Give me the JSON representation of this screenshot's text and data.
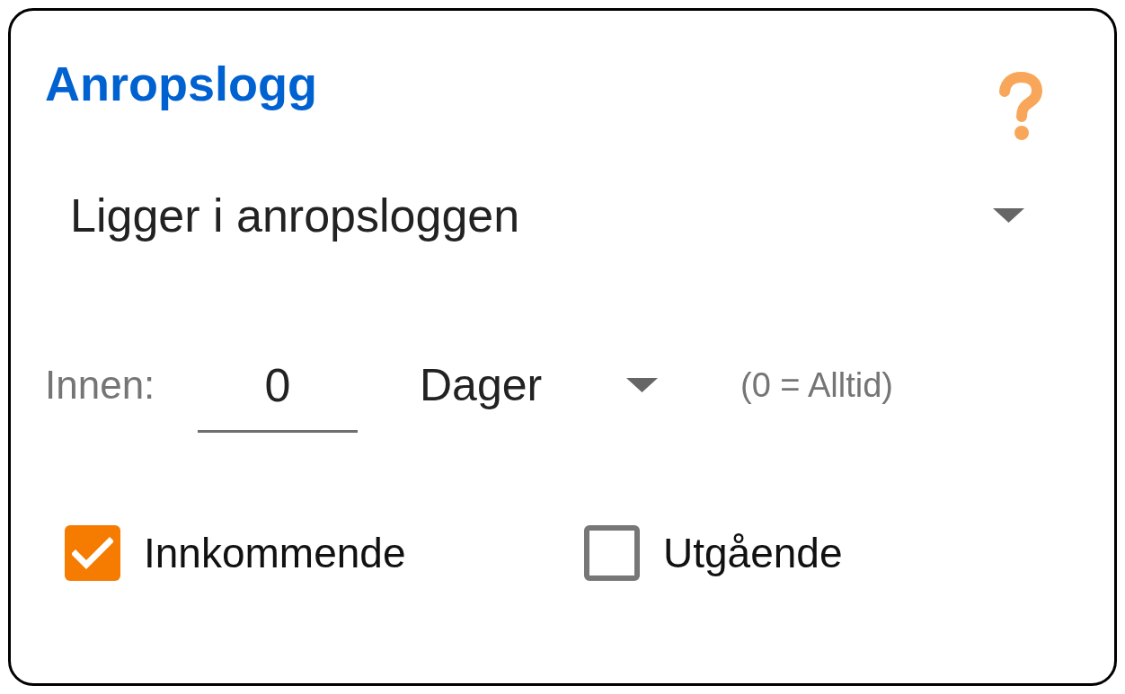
{
  "title": "Anropslogg",
  "condition_dropdown": {
    "value": "Ligger i anropsloggen"
  },
  "within": {
    "label": "Innen:",
    "value": "0",
    "unit_dropdown": {
      "value": "Dager"
    },
    "hint": "(0 = Alltid)"
  },
  "checkboxes": [
    {
      "label": "Innkommende",
      "checked": true
    },
    {
      "label": "Utgående",
      "checked": false
    }
  ]
}
